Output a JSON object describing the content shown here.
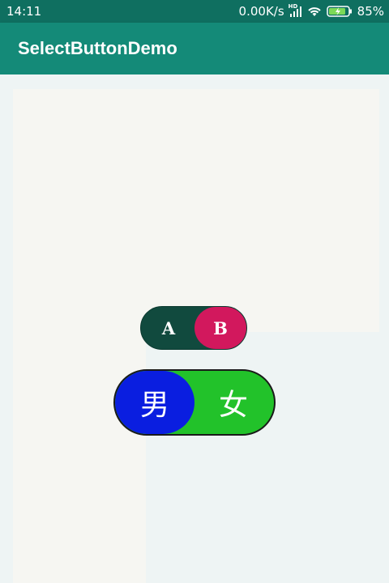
{
  "status_bar": {
    "time": "14:11",
    "network_speed": "0.00K/s",
    "hd_label": "HD",
    "battery_percent": "85%",
    "battery_level": 0.85,
    "signal_icon": "signal-icon",
    "wifi_icon": "wifi-icon",
    "battery_icon": "battery-charging-icon"
  },
  "app_bar": {
    "title": "SelectButtonDemo",
    "color": "#148a78"
  },
  "toggle_ab": {
    "option_left": "A",
    "option_right": "B",
    "selected": "B",
    "track_color": "#114a3e",
    "thumb_color": "#d2185d"
  },
  "toggle_gender": {
    "option_left": "男",
    "option_right": "女",
    "selected": "男",
    "track_color": "#22c22a",
    "thumb_color": "#0a1ee0"
  }
}
